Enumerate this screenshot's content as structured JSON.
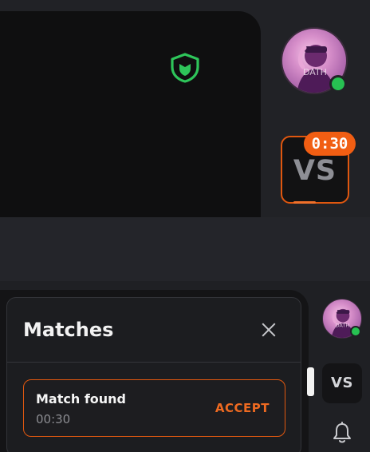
{
  "top_panel": {
    "shield_icon": "shield-icon",
    "shield_color": "#2ec55a",
    "avatar": {
      "label": "DATH",
      "status": "online"
    },
    "vs_button": {
      "label": "VS",
      "timer": "0:30"
    }
  },
  "bottom_panel": {
    "matches_card": {
      "title": "Matches",
      "close_icon": "close-icon",
      "items": [
        {
          "label": "Match found",
          "time": "00:30",
          "action": "ACCEPT"
        }
      ]
    },
    "avatar": {
      "label": "DATH",
      "status": "online"
    },
    "vs_button": {
      "label": "VS"
    },
    "bell_icon": "bell-icon"
  },
  "colors": {
    "accent_orange": "#f15e13",
    "status_green": "#27c152",
    "panel_dark": "#0f0f10"
  }
}
